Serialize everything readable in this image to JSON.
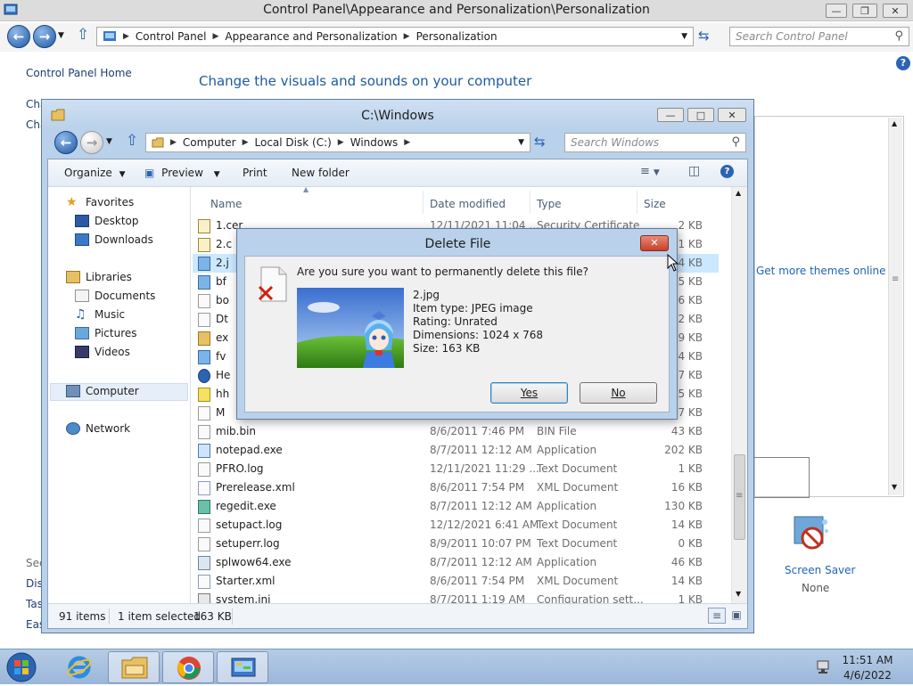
{
  "control_panel": {
    "title": "Control Panel\\Appearance and Personalization\\Personalization",
    "breadcrumb": [
      "Control Panel",
      "Appearance and Personalization",
      "Personalization"
    ],
    "search_placeholder": "Search Control Panel",
    "home_link": "Control Panel Home",
    "left_cut_links": [
      "Cha",
      "Cha",
      "See",
      "Dis",
      "Tas",
      "Eas"
    ],
    "main_title": "Change the visuals and sounds on your computer",
    "get_more_themes": "Get more themes online",
    "screen_saver_label": "Screen Saver",
    "screen_saver_value": "None"
  },
  "explorer": {
    "title": "C:\\Windows",
    "breadcrumb": [
      "Computer",
      "Local Disk (C:)",
      "Windows"
    ],
    "search_placeholder": "Search Windows",
    "toolbar": {
      "organize": "Organize",
      "preview": "Preview",
      "print": "Print",
      "new_folder": "New folder"
    },
    "nav": {
      "favorites": "Favorites",
      "desktop": "Desktop",
      "downloads": "Downloads",
      "libraries": "Libraries",
      "documents": "Documents",
      "music": "Music",
      "pictures": "Pictures",
      "videos": "Videos",
      "computer": "Computer",
      "network": "Network"
    },
    "columns": {
      "name": "Name",
      "date": "Date modified",
      "type": "Type",
      "size": "Size"
    },
    "files": [
      {
        "name": "1.cer",
        "date": "12/11/2021 11:04 ...",
        "type": "Security Certificate",
        "size": "2 KB",
        "icon": "certificate-icon"
      },
      {
        "name": "2.c",
        "date": "",
        "type": "",
        "size": "1 KB",
        "icon": "certificate-icon"
      },
      {
        "name": "2.j",
        "date": "",
        "type": "",
        "size": "164 KB",
        "icon": "image-icon",
        "selected": true
      },
      {
        "name": "bf",
        "date": "",
        "type": "",
        "size": "65 KB",
        "icon": "image-icon"
      },
      {
        "name": "bo",
        "date": "",
        "type": "",
        "size": "66 KB",
        "icon": "file-icon"
      },
      {
        "name": "Dt",
        "date": "",
        "type": "",
        "size": "2 KB",
        "icon": "file-icon"
      },
      {
        "name": "ex",
        "date": "",
        "type": "",
        "size": "839 KB",
        "icon": "folder-app-icon"
      },
      {
        "name": "fv",
        "date": "",
        "type": "",
        "size": "14 KB",
        "icon": "image-icon"
      },
      {
        "name": "He",
        "date": "",
        "type": "",
        "size": "767 KB",
        "icon": "help-icon"
      },
      {
        "name": "hh",
        "date": "",
        "type": "",
        "size": "15 KB",
        "icon": "help-file-icon"
      },
      {
        "name": "M",
        "date": "",
        "type": "",
        "size": "927 KB",
        "icon": "file-icon"
      },
      {
        "name": "mib.bin",
        "date": "8/6/2011 7:46 PM",
        "type": "BIN File",
        "size": "43 KB",
        "icon": "file-icon"
      },
      {
        "name": "notepad.exe",
        "date": "8/7/2011 12:12 AM",
        "type": "Application",
        "size": "202 KB",
        "icon": "notepad-icon"
      },
      {
        "name": "PFRO.log",
        "date": "12/11/2021 11:29 ...",
        "type": "Text Document",
        "size": "1 KB",
        "icon": "text-file-icon"
      },
      {
        "name": "Prerelease.xml",
        "date": "8/6/2011 7:54 PM",
        "type": "XML Document",
        "size": "16 KB",
        "icon": "xml-file-icon"
      },
      {
        "name": "regedit.exe",
        "date": "8/7/2011 12:12 AM",
        "type": "Application",
        "size": "130 KB",
        "icon": "regedit-icon"
      },
      {
        "name": "setupact.log",
        "date": "12/12/2021 6:41 AM",
        "type": "Text Document",
        "size": "14 KB",
        "icon": "text-file-icon"
      },
      {
        "name": "setuperr.log",
        "date": "8/9/2011 10:07 PM",
        "type": "Text Document",
        "size": "0 KB",
        "icon": "text-file-icon"
      },
      {
        "name": "splwow64.exe",
        "date": "8/7/2011 12:12 AM",
        "type": "Application",
        "size": "46 KB",
        "icon": "app-icon"
      },
      {
        "name": "Starter.xml",
        "date": "8/6/2011 7:54 PM",
        "type": "XML Document",
        "size": "14 KB",
        "icon": "xml-file-icon"
      },
      {
        "name": "system.ini",
        "date": "8/7/2011 1:19 AM",
        "type": "Configuration sett...",
        "size": "1 KB",
        "icon": "settings-file-icon"
      }
    ],
    "status": {
      "item_count": "91 items",
      "selection": "1 item selected",
      "selection_size": "163 KB"
    }
  },
  "dialog": {
    "title": "Delete File",
    "question": "Are you sure you want to permanently delete this file?",
    "file_name": "2.jpg",
    "item_type": "Item type: JPEG image",
    "rating": "Rating: Unrated",
    "dimensions": "Dimensions: 1024 x 768",
    "size": "Size: 163 KB",
    "yes_label": "Yes",
    "no_label": "No"
  },
  "taskbar": {
    "apps": [
      "internet-explorer-icon",
      "file-explorer-icon",
      "chrome-icon",
      "control-panel-icon"
    ],
    "time": "11:51 AM",
    "date": "4/6/2022"
  }
}
